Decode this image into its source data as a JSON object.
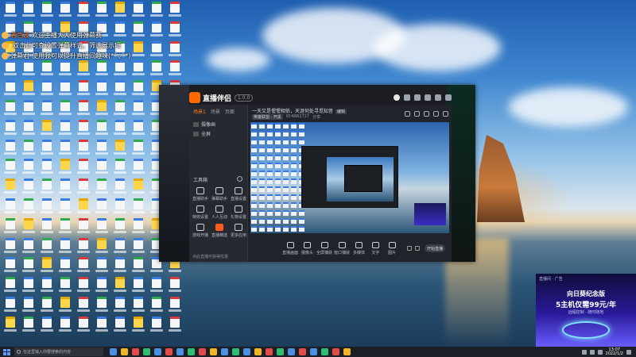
{
  "chat": [
    {
      "nick": "者色波",
      "text": "欢迎主播大大使用弹幕赛"
    },
    {
      "nick": "",
      "text": "双击此可查设置弹幕样式、筛选展示项"
    },
    {
      "nick": "弹幕君",
      "text": "使用我可以提升直播间趣味(*ˊ▽ˋ*)"
    }
  ],
  "app": {
    "brand": "直播伴侣",
    "version": "1.0.0",
    "side_tabs": [
      "场景1",
      "场景",
      "页面"
    ],
    "scenes": [
      "摄像画",
      "全屏"
    ],
    "tools_title": "工具箱",
    "tools": [
      {
        "label": "直播助手"
      },
      {
        "label": "弹幕助手"
      },
      {
        "label": "直播设置"
      },
      {
        "label": "特效设置"
      },
      {
        "label": "人人互动"
      },
      {
        "label": "礼物设置"
      },
      {
        "label": "游戏开播"
      },
      {
        "label": "直播精选"
      },
      {
        "label": "更多应用"
      }
    ],
    "side_footer": "点此直播可获得优惠",
    "room_title": "一天又是惺惺相依，天涯何处寻觅知音",
    "room_edit": "编辑",
    "room_meta": [
      "英雄联盟 · 开黑",
      "ID:6662727",
      "分享"
    ],
    "bottom_tools": [
      "直播画面",
      "摄像头",
      "全屏捕获",
      "窗口捕获",
      "多媒体",
      "文字",
      "图片"
    ],
    "start_button": "开始直播"
  },
  "overlay_ad": {
    "top": "直播间 · 广告",
    "headline": "向日葵纪念版",
    "price": "5主机仅需99元/年",
    "sub": "远程控制 · 随时随地"
  },
  "taskbar": {
    "search_placeholder": "在这里输入你要搜索的内容",
    "time": "13:07",
    "date": "2022/1/2"
  },
  "colors": {
    "accent": "#ff6a00",
    "taskbar": "#1b1f26"
  }
}
